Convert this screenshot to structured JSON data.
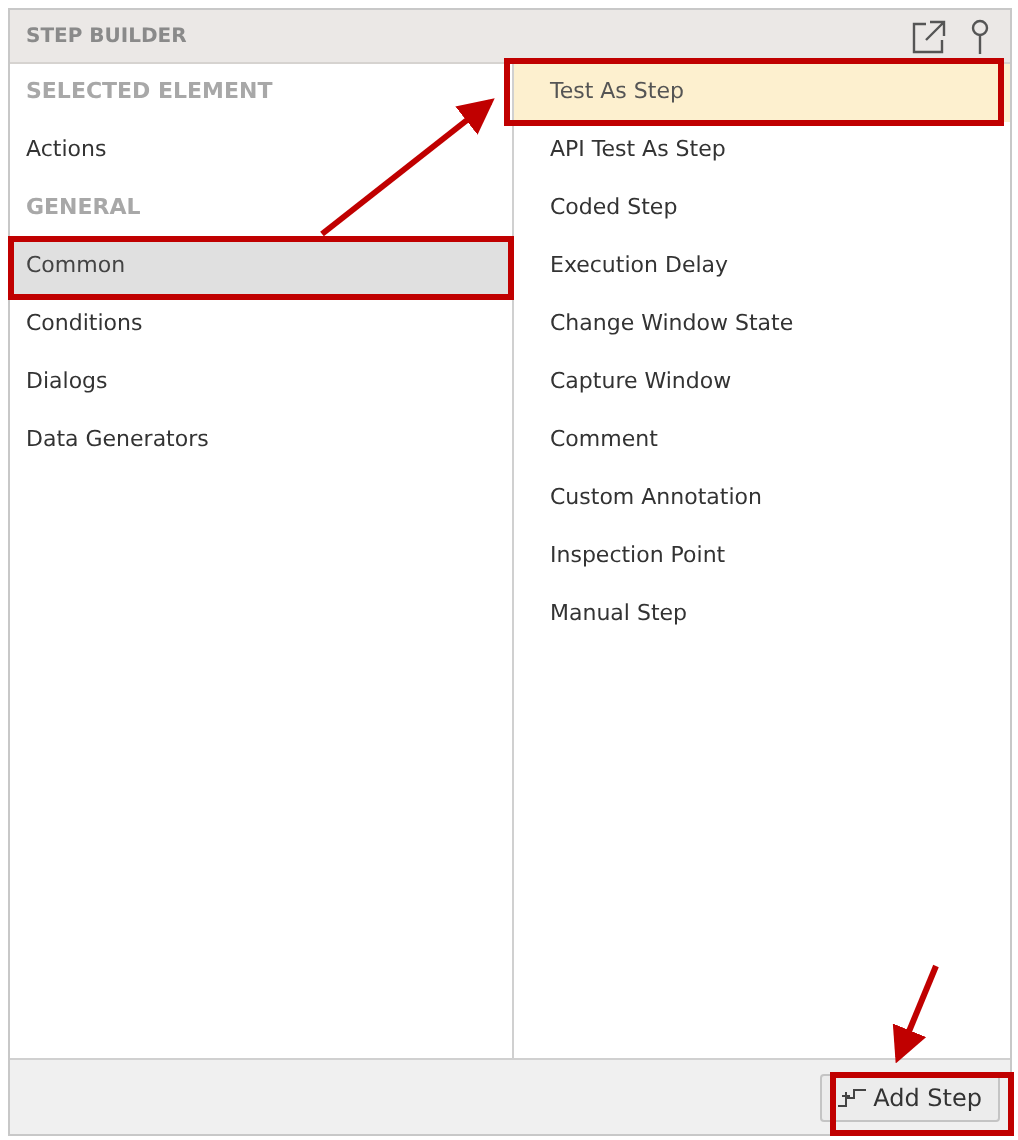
{
  "panel": {
    "title": "STEP BUILDER"
  },
  "categories": [
    {
      "kind": "header",
      "label": "SELECTED ELEMENT",
      "selected": false
    },
    {
      "kind": "item",
      "label": "Actions",
      "selected": false
    },
    {
      "kind": "header",
      "label": "GENERAL",
      "selected": false
    },
    {
      "kind": "item",
      "label": "Common",
      "selected": true
    },
    {
      "kind": "item",
      "label": "Conditions",
      "selected": false
    },
    {
      "kind": "item",
      "label": "Dialogs",
      "selected": false
    },
    {
      "kind": "item",
      "label": "Data Generators",
      "selected": false
    }
  ],
  "steps": [
    {
      "label": "Test As Step",
      "selected": true
    },
    {
      "label": "API Test As Step",
      "selected": false
    },
    {
      "label": "Coded Step",
      "selected": false
    },
    {
      "label": "Execution Delay",
      "selected": false
    },
    {
      "label": "Change Window State",
      "selected": false
    },
    {
      "label": "Capture Window",
      "selected": false
    },
    {
      "label": "Comment",
      "selected": false
    },
    {
      "label": "Custom Annotation",
      "selected": false
    },
    {
      "label": "Inspection Point",
      "selected": false
    },
    {
      "label": "Manual Step",
      "selected": false
    }
  ],
  "add_button": {
    "label": "Add Step"
  }
}
